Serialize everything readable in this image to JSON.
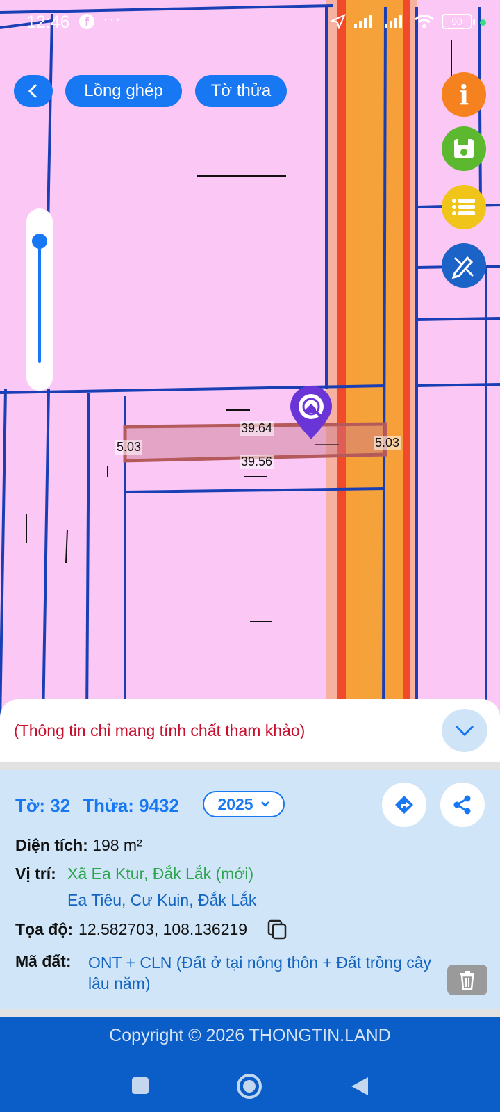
{
  "status_bar": {
    "time": "12:46",
    "battery": "90",
    "fb_icon": "facebook-icon",
    "dots": "···"
  },
  "toolbar": {
    "back_label": "<",
    "overlay_label": "Lồng ghép",
    "parcel_label": "Tờ thửa"
  },
  "side_buttons": [
    "info-icon",
    "save-icon",
    "list-icon",
    "draw-tool-icon"
  ],
  "map": {
    "parcel_edges": {
      "top": "39.64",
      "bottom": "39.56",
      "left": "5.03",
      "right": "5.03"
    },
    "zoom_level": 0.95,
    "colors": {
      "background": "#fbc8f6",
      "parcel_line": "#1a3fb4",
      "road": "#f7a03a",
      "road_edge": "#f04a2a",
      "parcel_highlight": "#b55a5a"
    }
  },
  "sheet": {
    "notice": "(Thông tin chỉ mang tính chất tham khảo)",
    "sheet_no": "Tờ: 32",
    "parcel_no": "Thửa: 9432",
    "year": "2025",
    "area_label": "Diện tích:",
    "area_value": "198 m²",
    "location_label": "Vị trí:",
    "location_new": "Xã Ea Ktur, Đắk Lắk (mới)",
    "location_old": "Ea Tiêu, Cư Kuin, Đắk Lắk",
    "coord_label": "Tọa độ:",
    "coord_value": "12.582703, 108.136219",
    "code_label": "Mã đất:",
    "code_value": "ONT + CLN (Đất ở tại nông thôn + Đất trồng cây lâu năm)"
  },
  "footer": {
    "copyright": "Copyright © 2026 THONGTIN.LAND"
  },
  "colors": {
    "primary": "#1877f2",
    "notice_red": "#c8102e",
    "panel_bg": "#d0e6f8",
    "footer_bg": "#0b5ec8"
  }
}
